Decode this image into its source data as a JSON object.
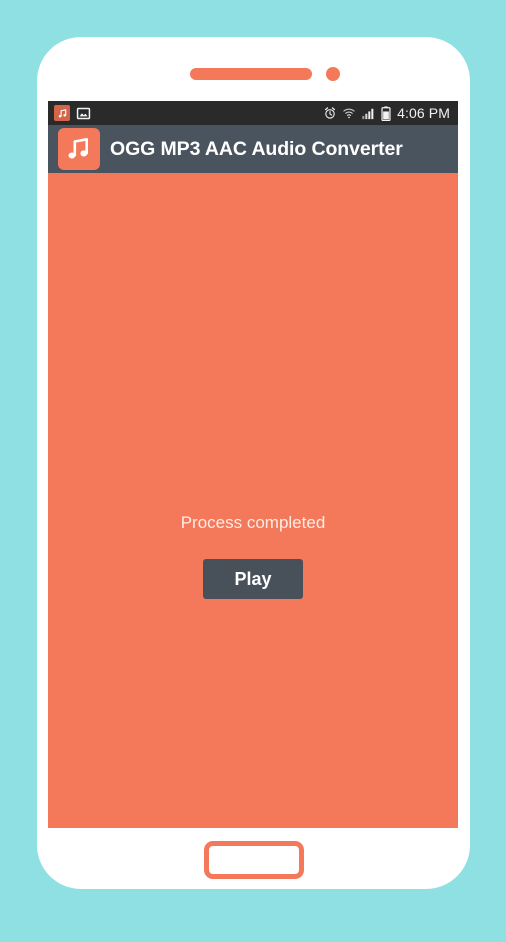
{
  "theme": {
    "page_background": "#8fe0e2",
    "device_body": "#ffffff",
    "accent_orange": "#f4795a",
    "action_bar": "#4a545e",
    "status_bar": "#2a2a2a",
    "button_dark": "#485059",
    "message_text": "#fdece6"
  },
  "device": {
    "speaker_name": "earpiece-speaker",
    "camera_name": "front-camera",
    "home_button_name": "home-button"
  },
  "status_bar": {
    "left_icons": [
      {
        "name": "app-notification-icon",
        "glyph": "music-note"
      },
      {
        "name": "gallery-icon",
        "glyph": "image"
      }
    ],
    "right_icons": [
      {
        "name": "alarm-icon",
        "glyph": "alarm-clock"
      },
      {
        "name": "wifi-icon",
        "glyph": "wifi"
      },
      {
        "name": "signal-icon",
        "glyph": "signal-bars"
      },
      {
        "name": "battery-icon",
        "glyph": "battery"
      }
    ],
    "clock": "4:06 PM"
  },
  "action_bar": {
    "logo_icon": "app-logo-music-note-icon",
    "title": "OGG MP3 AAC Audio Converter"
  },
  "content": {
    "status_message": "Process completed",
    "play_button_label": "Play"
  }
}
